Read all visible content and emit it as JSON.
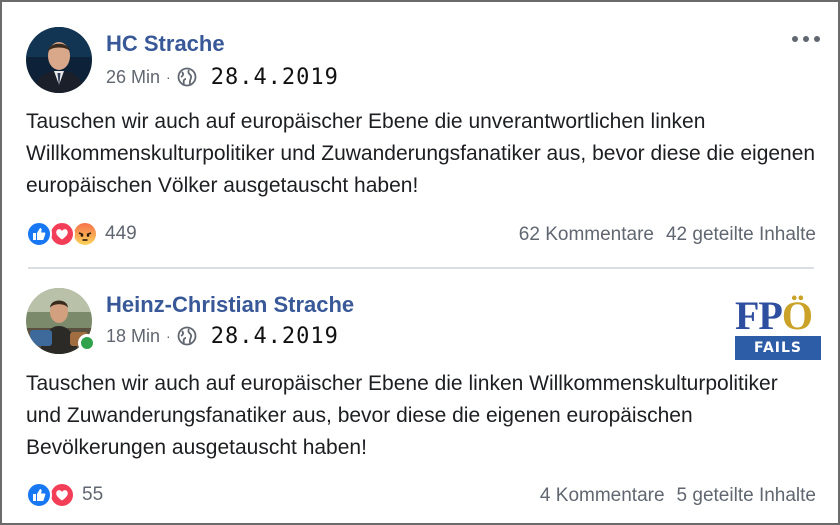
{
  "posts": [
    {
      "author": "HC Strache",
      "time": "26 Min",
      "dot": "·",
      "date": "28.4.2019",
      "text": "Tauschen wir auch auf europäischer Ebene die unverantwortlichen linken Willkommenskulturpolitiker und Zuwanderungsfanatiker aus, bevor diese die eigenen europäischen Völker ausgetauscht haben!",
      "reactions": [
        "like-icon",
        "love-icon",
        "angry-icon"
      ],
      "reaction_count": "449",
      "comments": "62 Kommentare",
      "shares": "42 geteilte Inhalte"
    },
    {
      "author": "Heinz-Christian Strache",
      "time": "18 Min",
      "dot": "·",
      "date": "28.4.2019",
      "text": "Tauschen wir auch auf europäischer Ebene die linken Willkommenskulturpolitiker und Zuwanderungsfanatiker aus, bevor diese die eigenen europäischen Bevölkerungen ausgetauscht haben!",
      "reactions": [
        "like-icon",
        "love-icon"
      ],
      "reaction_count": "55",
      "comments": "4 Kommentare",
      "shares": "5 geteilte Inhalte"
    }
  ],
  "watermark": {
    "fp": "FP",
    "o": "Ö",
    "fails": "FAILS"
  },
  "colors": {
    "author_link": "#385898",
    "like": "#1877f2",
    "love": "#f33e58",
    "online": "#31a24c",
    "fpo_blue": "#2e4fa0",
    "fpo_gold": "#c9a227"
  }
}
